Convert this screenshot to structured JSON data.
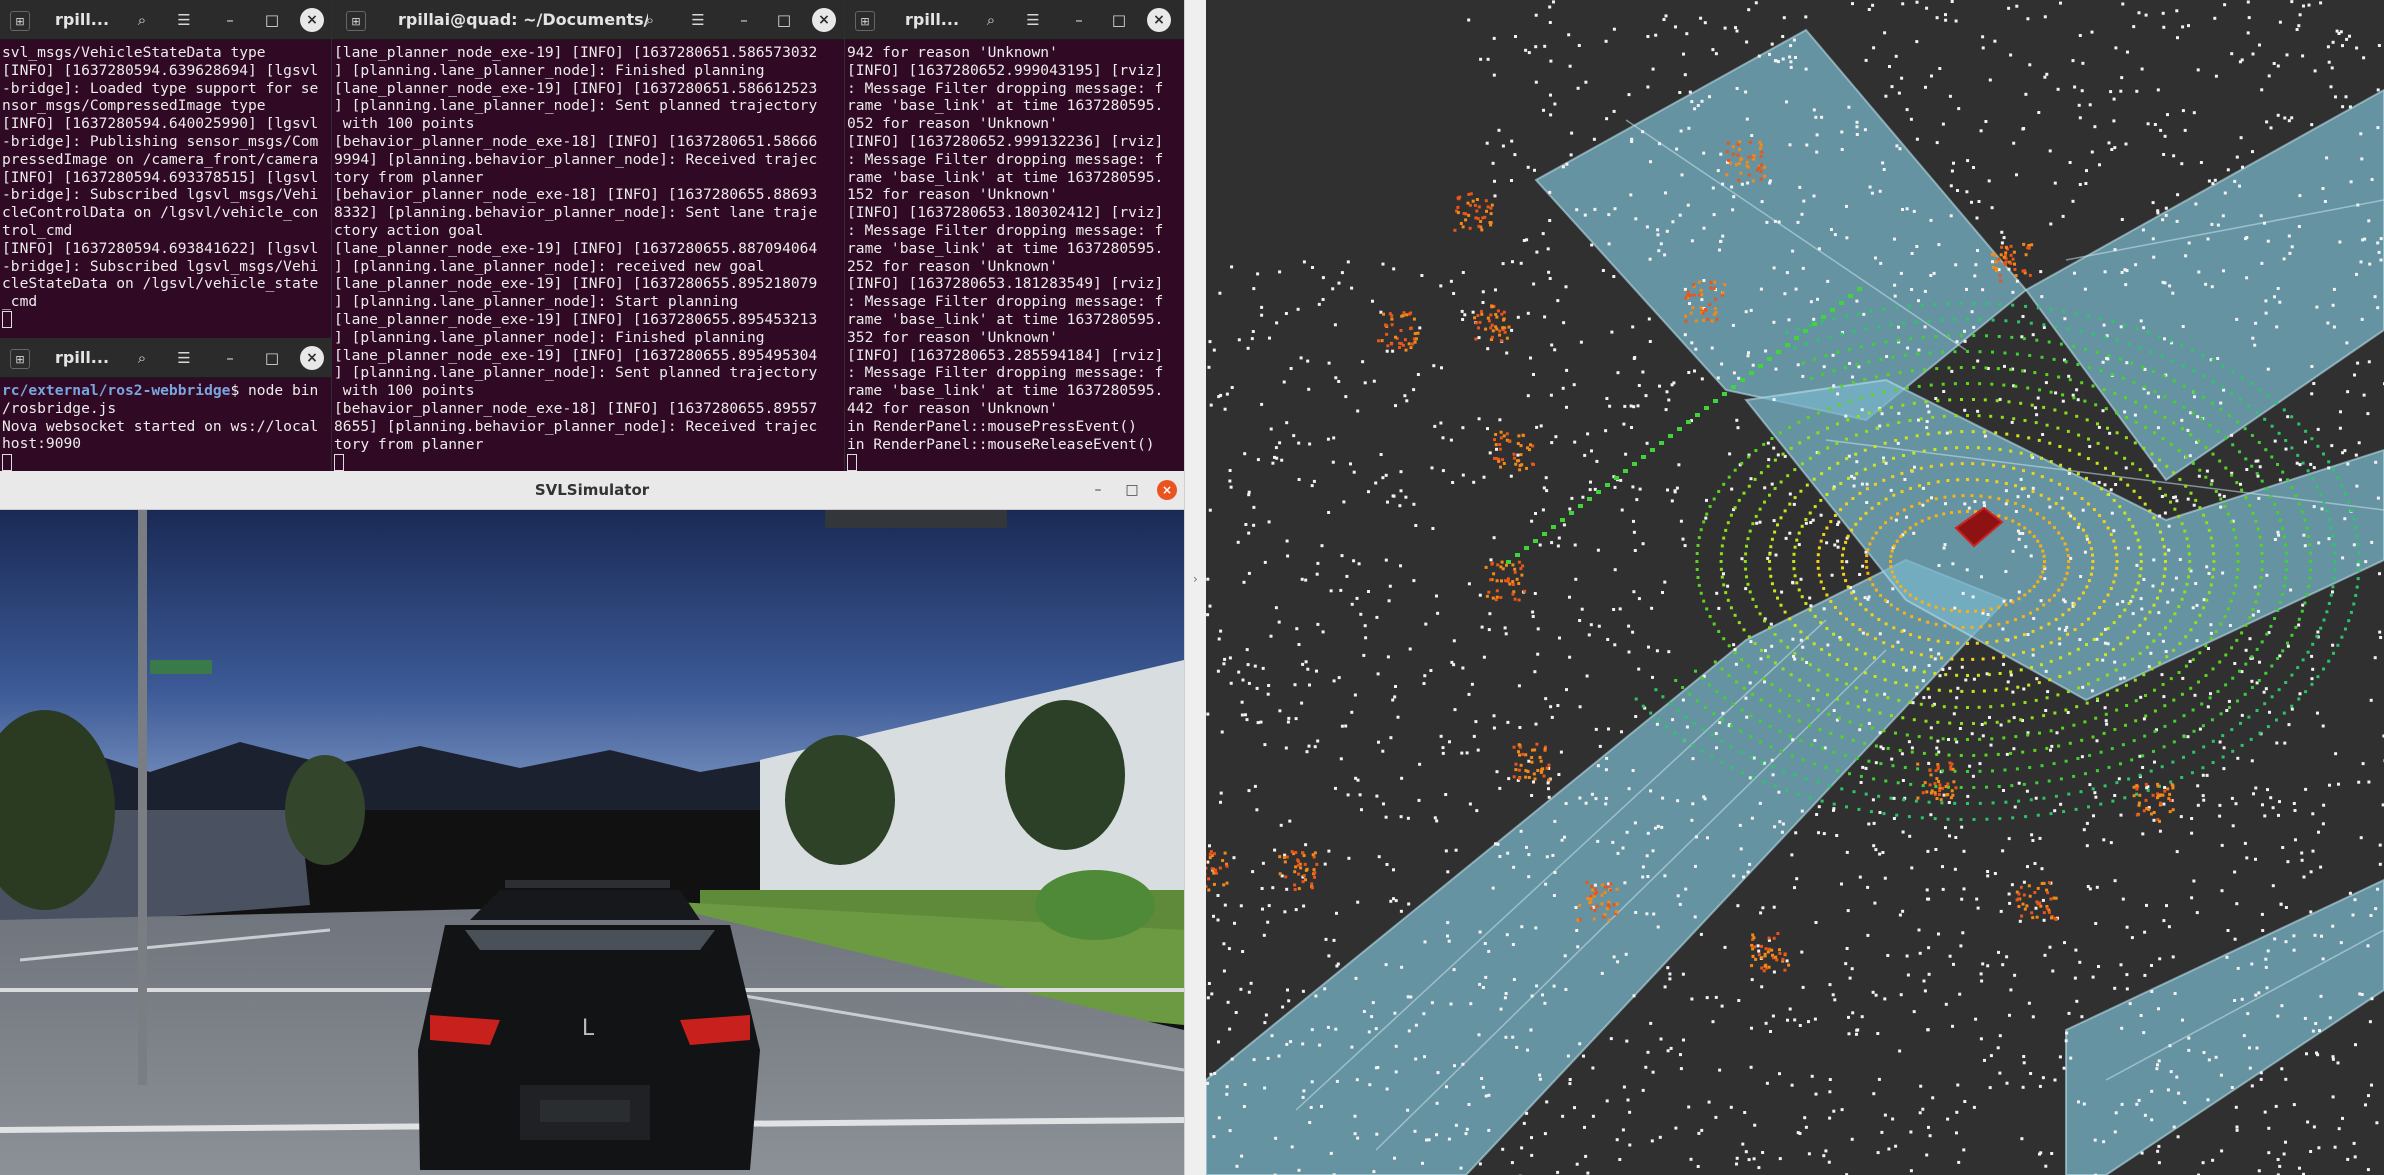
{
  "terminal1": {
    "title": "rpill...",
    "lines": [
      "svl_msgs/VehicleStateData type",
      "[INFO] [1637280594.639628694] [lgsvl",
      "-bridge]: Loaded type support for se",
      "nsor_msgs/CompressedImage type",
      "[INFO] [1637280594.640025990] [lgsvl",
      "-bridge]: Publishing sensor_msgs/Com",
      "pressedImage on /camera_front/camera",
      "[INFO] [1637280594.693378515] [lgsvl",
      "-bridge]: Subscribed lgsvl_msgs/Vehi",
      "cleControlData on /lgsvl/vehicle_con",
      "trol_cmd",
      "[INFO] [1637280594.693841622] [lgsvl",
      "-bridge]: Subscribed lgsvl_msgs/Vehi",
      "cleStateData on /lgsvl/vehicle_state",
      "_cmd"
    ]
  },
  "terminal2": {
    "title": "rpillai@quad: ~/Documents/...",
    "lines": [
      "[lane_planner_node_exe-19] [INFO] [1637280651.586573032",
      "] [planning.lane_planner_node]: Finished planning",
      "[lane_planner_node_exe-19] [INFO] [1637280651.586612523",
      "] [planning.lane_planner_node]: Sent planned trajectory",
      " with 100 points",
      "[behavior_planner_node_exe-18] [INFO] [1637280651.58666",
      "9994] [planning.behavior_planner_node]: Received trajec",
      "tory from planner",
      "[behavior_planner_node_exe-18] [INFO] [1637280655.88693",
      "8332] [planning.behavior_planner_node]: Sent lane traje",
      "ctory action goal",
      "[lane_planner_node_exe-19] [INFO] [1637280655.887094064",
      "] [planning.lane_planner_node]: received new goal",
      "[lane_planner_node_exe-19] [INFO] [1637280655.895218079",
      "] [planning.lane_planner_node]: Start planning",
      "[lane_planner_node_exe-19] [INFO] [1637280655.895453213",
      "] [planning.lane_planner_node]: Finished planning",
      "[lane_planner_node_exe-19] [INFO] [1637280655.895495304",
      "] [planning.lane_planner_node]: Sent planned trajectory",
      " with 100 points",
      "[behavior_planner_node_exe-18] [INFO] [1637280655.89557",
      "8655] [planning.behavior_planner_node]: Received trajec",
      "tory from planner"
    ]
  },
  "terminal3": {
    "title": "rpill...",
    "lines": [
      "942 for reason 'Unknown'",
      "[INFO] [1637280652.999043195] [rviz]",
      ": Message Filter dropping message: f",
      "rame 'base_link' at time 1637280595.",
      "052 for reason 'Unknown'",
      "[INFO] [1637280652.999132236] [rviz]",
      ": Message Filter dropping message: f",
      "rame 'base_link' at time 1637280595.",
      "152 for reason 'Unknown'",
      "[INFO] [1637280653.180302412] [rviz]",
      ": Message Filter dropping message: f",
      "rame 'base_link' at time 1637280595.",
      "252 for reason 'Unknown'",
      "[INFO] [1637280653.181283549] [rviz]",
      ": Message Filter dropping message: f",
      "rame 'base_link' at time 1637280595.",
      "352 for reason 'Unknown'",
      "[INFO] [1637280653.285594184] [rviz]",
      ": Message Filter dropping message: f",
      "rame 'base_link' at time 1637280595.",
      "442 for reason 'Unknown'",
      "in RenderPanel::mousePressEvent()",
      "in RenderPanel::mouseReleaseEvent()"
    ]
  },
  "terminal4": {
    "title": "rpill...",
    "prompt_path": "rc/external/ros2-webbridge",
    "prompt_cmd": "$ node bin",
    "lines": [
      "/rosbridge.js",
      "Nova websocket started on ws://local",
      "host:9090"
    ]
  },
  "simulator": {
    "title": "SVLSimulator",
    "car_brand_mark": "L"
  },
  "icons": {
    "pin": "pin-icon",
    "search": "search-icon",
    "menu": "hamburger-menu-icon",
    "minimize": "minimize-icon",
    "maximize": "maximize-icon",
    "close": "close-icon"
  },
  "colors": {
    "terminal_bg": "#300a24",
    "titlebar_bg": "#2b2b2b",
    "sim_close": "#e95420",
    "rviz_bg": "#303030",
    "lane_fill": "#78b4c8"
  }
}
